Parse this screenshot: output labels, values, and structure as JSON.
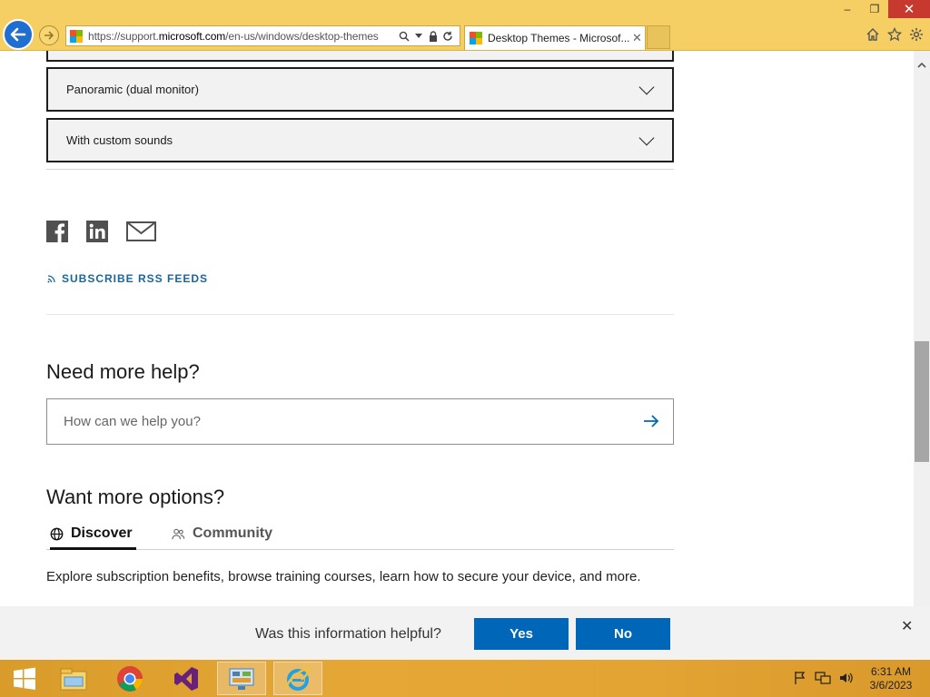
{
  "browser": {
    "url_prefix": "https://support.",
    "url_domain": "microsoft.com",
    "url_path": "/en-us/windows/desktop-themes",
    "tab_title": "Desktop Themes - Microsof...",
    "window_controls": {
      "minimize": "–",
      "restore": "❐",
      "close": "✕"
    },
    "close_tab_glyph": "✕"
  },
  "page": {
    "accordions": [
      {
        "label": "Panoramic (dual monitor)"
      },
      {
        "label": "With custom sounds"
      }
    ],
    "social": [
      "facebook-icon",
      "linkedin-icon",
      "email-icon"
    ],
    "rss_label": "SUBSCRIBE RSS FEEDS",
    "need_help_heading": "Need more help?",
    "search_placeholder": "How can we help you?",
    "options_heading": "Want more options?",
    "tabs": [
      {
        "label": "Discover",
        "active": true
      },
      {
        "label": "Community",
        "active": false
      }
    ],
    "explore_text": "Explore subscription benefits, browse training courses, learn how to secure your device, and more."
  },
  "feedback": {
    "question": "Was this information helpful?",
    "yes": "Yes",
    "no": "No",
    "close_glyph": "✕"
  },
  "taskbar": {
    "apps": [
      "start-icon",
      "file-explorer-icon",
      "chrome-icon",
      "visual-studio-icon",
      "control-panel-icon",
      "internet-explorer-icon"
    ],
    "time": "6:31 AM",
    "date": "3/6/2023"
  },
  "colors": {
    "accent": "#0067b8",
    "rss": "#1a6699",
    "chrome": "#f5ce64",
    "taskbar": "#e3a434"
  }
}
